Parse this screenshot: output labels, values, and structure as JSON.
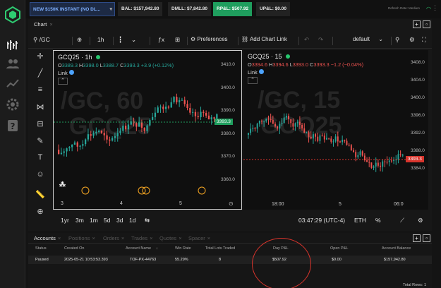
{
  "topbar": {
    "account": "NEW $150K INSTANT (NO DL...",
    "bal": "BAL: $157,942.80",
    "dmll": "DMLL: $7,842.80",
    "rpl": "RP&L: $507.92",
    "upl": "UP&L: $0.00",
    "refresh": "Refresh Rate: Medium"
  },
  "chart_window": {
    "tab": "Chart",
    "toolbar": {
      "symbol": "/GC",
      "interval": "1h",
      "preferences": "Preferences",
      "add_chart_link": "Add Chart Link",
      "layout": "default"
    },
    "pane1": {
      "title": "GCQ25 · 1h",
      "o": "3389.3",
      "h": "3398.0",
      "l": "3388.7",
      "c": "3393.3",
      "chg": "+3.9 (+0.12%)",
      "link": "Link",
      "watermark1": "/GC, 60",
      "watermark2": "GCQ25",
      "yticks": [
        "3410.0",
        "3400.0",
        "3390.0",
        "3380.0",
        "3370.0",
        "3360.0"
      ],
      "last_price": "3393.3",
      "xticks": [
        "3",
        "4",
        "5"
      ]
    },
    "pane2": {
      "title": "GCQ25 · 15",
      "o": "3394.6",
      "h": "3394.6",
      "l": "3393.0",
      "c": "3393.3",
      "chg": "−1.2 (−0.04%)",
      "link": "Link",
      "watermark1": "/GC, 15",
      "watermark2": "GCQ25",
      "yticks": [
        "3408.0",
        "3404.0",
        "3400.0",
        "3396.0",
        "3392.0",
        "3388.0",
        "3384.0"
      ],
      "last_price": "3393.3",
      "xticks": [
        "18:00",
        "5",
        "06:0"
      ]
    },
    "bottombar": {
      "ranges": [
        "1yr",
        "3m",
        "1m",
        "5d",
        "3d",
        "1d"
      ],
      "clock": "03:47:29 (UTC-4)",
      "session": "ETH",
      "pct": "%"
    }
  },
  "accounts_panel": {
    "tabs": [
      "Accounts",
      "Positions",
      "Orders",
      "Trades",
      "Quotes",
      "Spacer"
    ],
    "columns": [
      "Status",
      "Created On",
      "Account Name",
      "Win Rate",
      "Total Lots Traded",
      "Day P&L",
      "Open P&L",
      "Account Balance"
    ],
    "rows": [
      [
        "Paused",
        "2025-05-21 10:53:53.393",
        "TOF-PX-44763",
        "55.29%",
        "8",
        "$507.92",
        "$0.00",
        "$157,942.80"
      ]
    ],
    "total_rows": "Total Rows: 1"
  },
  "colors": {
    "up": "#26a69a",
    "down": "#ef5350",
    "accent": "#1f9e5e",
    "annotation": "#d8342c"
  }
}
